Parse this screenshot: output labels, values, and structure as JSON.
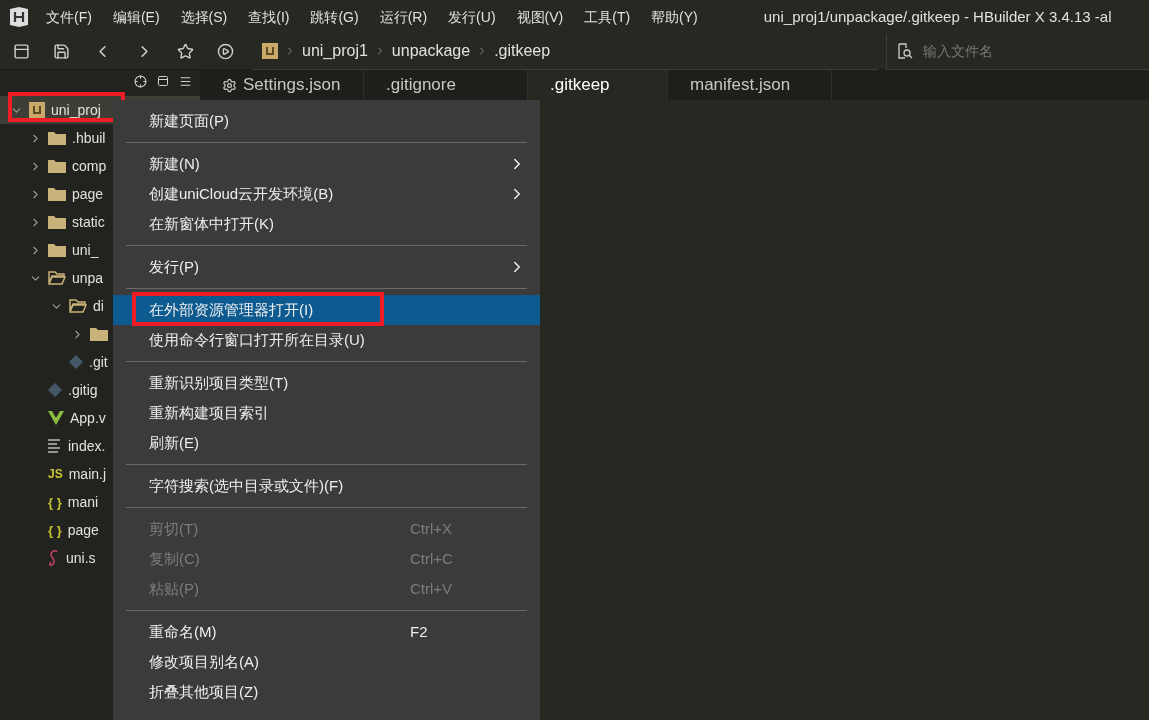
{
  "menubar": {
    "items": [
      "文件(F)",
      "编辑(E)",
      "选择(S)",
      "查找(I)",
      "跳转(G)",
      "运行(R)",
      "发行(U)",
      "视图(V)",
      "工具(T)",
      "帮助(Y)"
    ]
  },
  "window": {
    "title": "uni_proj1/unpackage/.gitkeep - HBuilder X 3.4.13 -al"
  },
  "breadcrumb": [
    "uni_proj1",
    "unpackage",
    ".gitkeep"
  ],
  "file_search": {
    "placeholder": "输入文件名"
  },
  "tabs": [
    {
      "label": "Settings.json",
      "kind": "settings",
      "selected": false
    },
    {
      "label": ".gitignore",
      "kind": "file",
      "selected": false
    },
    {
      "label": ".gitkeep",
      "kind": "file",
      "selected": true
    },
    {
      "label": "manifest.json",
      "kind": "file",
      "selected": false
    }
  ],
  "tree": [
    {
      "label": "uni_proj",
      "kind": "project",
      "expanded": true,
      "selected": true,
      "annotated": true,
      "children": [
        {
          "label": ".hbuil",
          "kind": "folder",
          "expanded": false
        },
        {
          "label": "comp",
          "kind": "folder",
          "expanded": false
        },
        {
          "label": "page",
          "kind": "folder",
          "expanded": false
        },
        {
          "label": "static",
          "kind": "folder",
          "expanded": false
        },
        {
          "label": "uni_",
          "kind": "folder",
          "expanded": false
        },
        {
          "label": "unpa",
          "kind": "folder",
          "expanded": true,
          "children": [
            {
              "label": "di",
              "kind": "folder",
              "expanded": true,
              "children": [
                {
                  "kind": "folder",
                  "expanded": false
                }
              ]
            },
            {
              "label": ".git",
              "kind": "git"
            }
          ]
        },
        {
          "label": ".gitig",
          "kind": "git"
        },
        {
          "label": "App.v",
          "kind": "vue"
        },
        {
          "label": "index.",
          "kind": "lines"
        },
        {
          "label": "main.j",
          "kind": "js",
          "icon_text": "JS"
        },
        {
          "label": "mani",
          "kind": "json",
          "icon_text": "{ }"
        },
        {
          "label": "page",
          "kind": "json",
          "icon_text": "{ }"
        },
        {
          "label": "uni.s",
          "kind": "sass"
        }
      ]
    }
  ],
  "context_menu": [
    {
      "kind": "item",
      "label": "新建页面(P)",
      "submenu": false,
      "disabled": false,
      "selected": false,
      "annotated": false
    },
    {
      "kind": "separator"
    },
    {
      "kind": "item",
      "label": "新建(N)",
      "submenu": true,
      "disabled": false,
      "selected": false,
      "annotated": false
    },
    {
      "kind": "item",
      "label": "创建uniCloud云开发环境(B)",
      "submenu": true,
      "disabled": false,
      "selected": false,
      "annotated": false
    },
    {
      "kind": "item",
      "label": "在新窗体中打开(K)",
      "submenu": false,
      "disabled": false,
      "selected": false,
      "annotated": false
    },
    {
      "kind": "separator"
    },
    {
      "kind": "item",
      "label": "发行(P)",
      "submenu": true,
      "disabled": false,
      "selected": false,
      "annotated": false
    },
    {
      "kind": "separator"
    },
    {
      "kind": "item",
      "label": "在外部资源管理器打开(I)",
      "submenu": false,
      "disabled": false,
      "selected": true,
      "annotated": true
    },
    {
      "kind": "item",
      "label": "使用命令行窗口打开所在目录(U)",
      "submenu": false,
      "disabled": false,
      "selected": false,
      "annotated": false
    },
    {
      "kind": "separator"
    },
    {
      "kind": "item",
      "label": "重新识别项目类型(T)",
      "submenu": false,
      "disabled": false,
      "selected": false,
      "annotated": false
    },
    {
      "kind": "item",
      "label": "重新构建项目索引",
      "submenu": false,
      "disabled": false,
      "selected": false,
      "annotated": false
    },
    {
      "kind": "item",
      "label": "刷新(E)",
      "submenu": false,
      "disabled": false,
      "selected": false,
      "annotated": false
    },
    {
      "kind": "separator"
    },
    {
      "kind": "item",
      "label": "字符搜索(选中目录或文件)(F)",
      "submenu": false,
      "disabled": false,
      "selected": false,
      "annotated": false
    },
    {
      "kind": "separator"
    },
    {
      "kind": "item",
      "label": "剪切(T)",
      "shortcut": "Ctrl+X",
      "submenu": false,
      "disabled": true,
      "selected": false,
      "annotated": false
    },
    {
      "kind": "item",
      "label": "复制(C)",
      "shortcut": "Ctrl+C",
      "submenu": false,
      "disabled": true,
      "selected": false,
      "annotated": false
    },
    {
      "kind": "item",
      "label": "粘贴(P)",
      "shortcut": "Ctrl+V",
      "submenu": false,
      "disabled": true,
      "selected": false,
      "annotated": false
    },
    {
      "kind": "separator"
    },
    {
      "kind": "item",
      "label": "重命名(M)",
      "shortcut": "F2",
      "submenu": false,
      "disabled": false,
      "selected": false,
      "annotated": false
    },
    {
      "kind": "item",
      "label": "修改项目别名(A)",
      "submenu": false,
      "disabled": false,
      "selected": false,
      "annotated": false
    },
    {
      "kind": "item",
      "label": "折叠其他项目(Z)",
      "submenu": false,
      "disabled": false,
      "selected": false,
      "annotated": false
    }
  ]
}
